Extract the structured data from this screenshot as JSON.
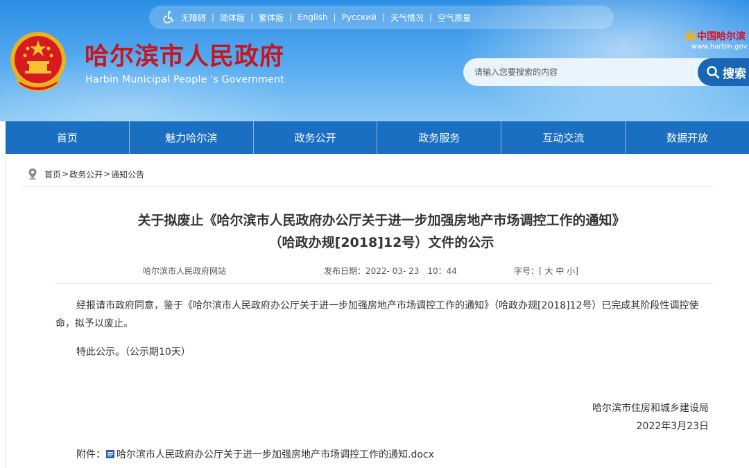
{
  "topbar": {
    "items": [
      "无障碍",
      "简体版",
      "繁体版",
      "English",
      "Русский",
      "天气情况",
      "空气质量"
    ]
  },
  "header": {
    "title": "哈尔滨市人民政府",
    "subtitle": "Harbin Municipal People 's Government",
    "brand_cn": "中国哈尔滨",
    "brand_url": "www.harbin.gov.cn"
  },
  "search": {
    "placeholder": "请输入您要搜索的内容",
    "button_label": "搜索"
  },
  "nav": {
    "items": [
      "首页",
      "魅力哈尔滨",
      "政务公开",
      "政务服务",
      "互动交流",
      "数据开放"
    ]
  },
  "breadcrumb": {
    "home": "首页",
    "section": "政务公开",
    "page": "通知公告",
    "separator": ">"
  },
  "article": {
    "title_line1": "关于拟废止《哈尔滨市人民政府办公厅关于进一步加强房地产市场调控工作的通知》",
    "title_line2": "（哈政办规[2018]12号）文件的公示",
    "source": "哈尔滨市人民政府网站",
    "publish_label": "发布日期：",
    "publish_date": "2022- 03- 23　10：44",
    "font_size_label": "字号：[",
    "font_large": "大",
    "font_medium": "中",
    "font_small": "小",
    "font_size_close": "]",
    "paragraph1": "经报请市政府同意，鉴于《哈尔滨市人民政府办公厅关于进一步加强房地产市场调控工作的通知》（哈政办规[2018]12号）已完成其阶段性调控使命，拟予以废止。",
    "paragraph2": "特此公示。（公示期10天）",
    "signature_org": "哈尔滨市住房和城乡建设局",
    "signature_date": "2022年3月23日",
    "attachment_label": "附件：",
    "attachment_name": "哈尔滨市人民政府办公厅关于进一步加强房地产市场调控工作的通知.docx"
  },
  "colors": {
    "header_blue": "#2b8ee6",
    "nav_blue": "#1a6fc2",
    "search_button": "#1866b4",
    "title_red": "#c8151b"
  }
}
